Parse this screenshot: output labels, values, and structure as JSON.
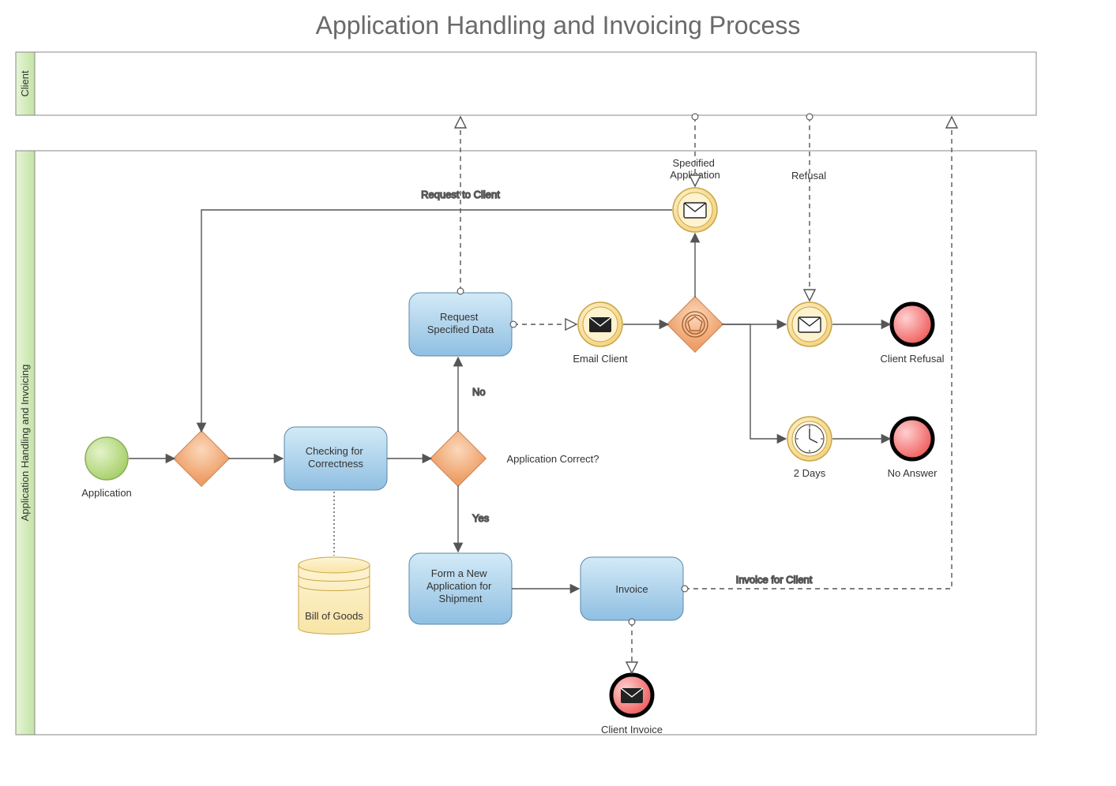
{
  "title": "Application Handling and Invoicing Process",
  "lanes": {
    "client": "Client",
    "main": "Application Handling and Invoicing"
  },
  "nodes": {
    "start": "Application",
    "check": "Checking for Correctness",
    "gwAppCorrect": "Application Correct?",
    "gwNo": "No",
    "gwYes": "Yes",
    "reqData": "Request Specified Data",
    "reqToClient": "Request to Client",
    "emailClient": "Email Client",
    "specApp": "Specified Application",
    "refusal": "Refusal",
    "clientRefusal": "Client Refusal",
    "twoDays": "2 Days",
    "noAnswer": "No Answer",
    "formNew": "Form a New Application for Shipment",
    "invoice": "Invoice",
    "invoiceForClient": "Invoice for Client",
    "clientInvoice": "Client Invoice",
    "billOfGoods": "Bill of Goods"
  },
  "colors": {
    "laneFill": "#d4ecc1",
    "laneStroke": "#888888",
    "taskFillTop": "#bfe0f3",
    "taskFillBottom": "#8fbfe2",
    "taskStroke": "#5a88aa",
    "gatewayFill": "#f3b48a",
    "gatewayStroke": "#c78253",
    "startFill": "#c5e49a",
    "startStroke": "#8aae5a",
    "endFill": "#f77a7a",
    "endStroke": "#000000",
    "msgFillOuter": "#ffe29a",
    "msgFillInner": "#fff0c4",
    "msgStroke": "#c9a648",
    "dataFill": "#fff0c4",
    "dataStroke": "#c9a648"
  }
}
